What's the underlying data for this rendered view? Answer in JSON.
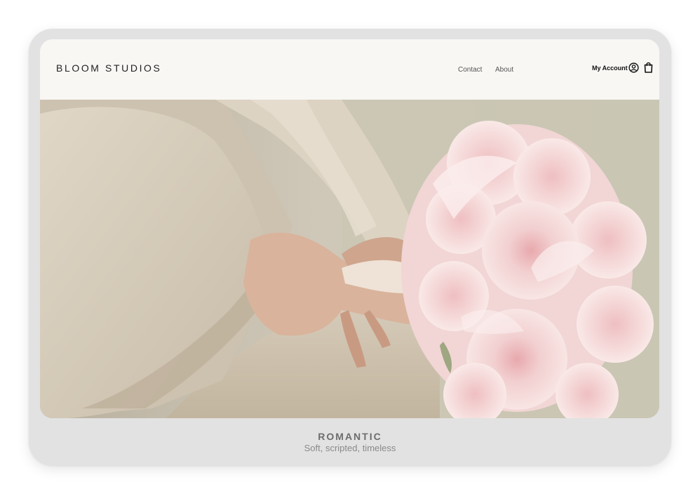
{
  "site": {
    "brand": "BLOOM STUDIOS"
  },
  "nav": {
    "links": [
      "Contact",
      "About"
    ]
  },
  "account": {
    "label": "My Account",
    "account_icon": "user-circle-icon",
    "cart_icon": "shopping-bag-icon"
  },
  "hero": {
    "image": "bride-holding-pink-peony-bouquet"
  },
  "caption": {
    "title": "ROMANTIC",
    "subtitle": "Soft, scripted, timeless"
  },
  "colors": {
    "frame": "#e2e2e2",
    "header_bg": "#f8f7f4",
    "peony_pink": "#f1d2d2",
    "dress_beige": "#d8cdbd"
  }
}
